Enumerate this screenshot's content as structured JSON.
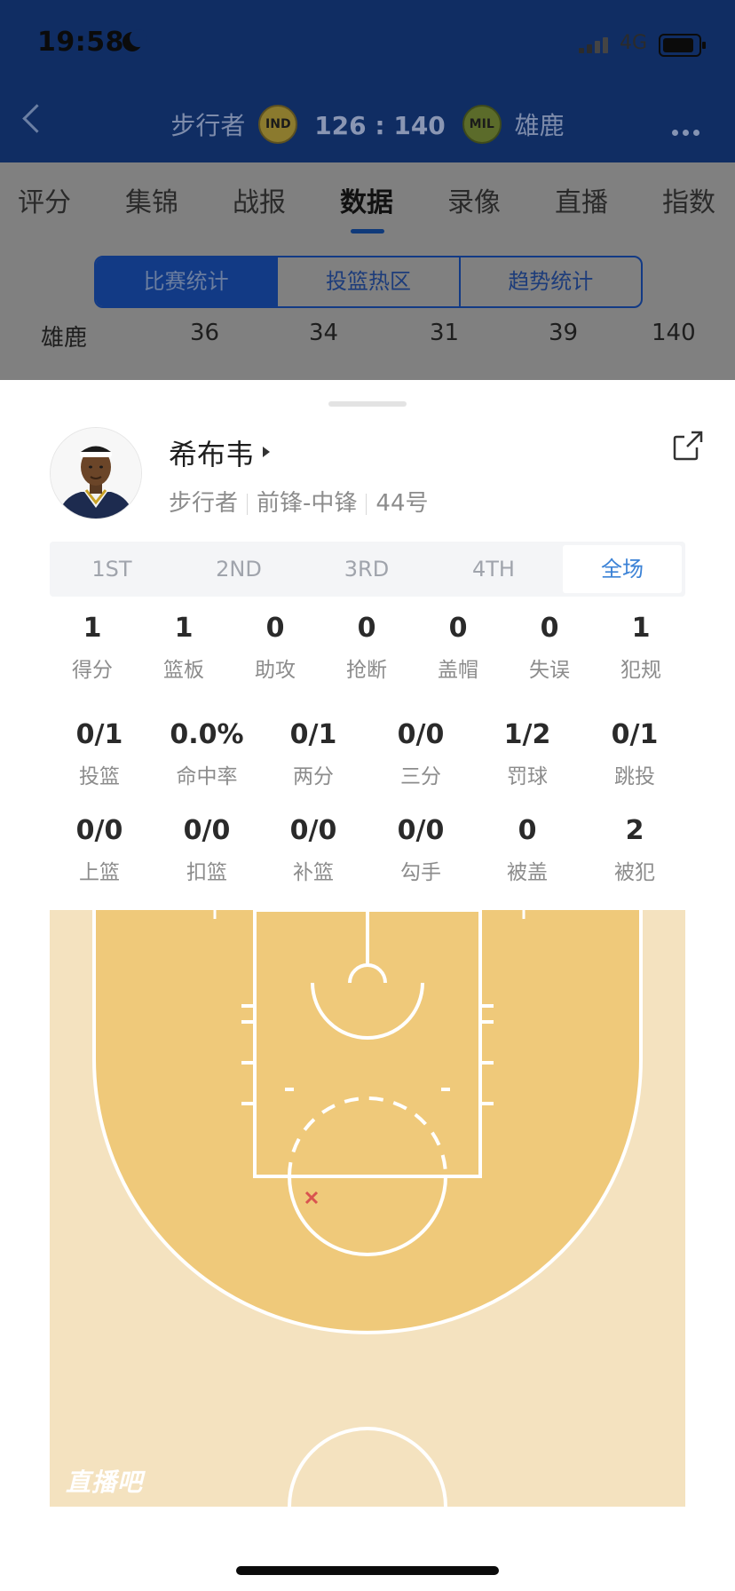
{
  "status_bar": {
    "time": "19:58",
    "network": "4G"
  },
  "header": {
    "home_team": "步行者",
    "home_logo_text": "IND",
    "score": "126 : 140",
    "away_logo_text": "MIL",
    "away_team": "雄鹿"
  },
  "tabs": [
    "评分",
    "集锦",
    "战报",
    "数据",
    "录像",
    "直播",
    "指数"
  ],
  "active_tab": "数据",
  "segments": [
    "比赛统计",
    "投篮热区",
    "趋势统计"
  ],
  "quarter_row": {
    "team": "雄鹿",
    "q1": "36",
    "q2": "34",
    "q3": "31",
    "q4": "39",
    "total": "140"
  },
  "player": {
    "name": "希布韦",
    "team": "步行者",
    "position": "前锋-中锋",
    "number": "44号"
  },
  "periods": [
    "1ST",
    "2ND",
    "3RD",
    "4TH",
    "全场"
  ],
  "active_period": "全场",
  "stats_row1": [
    {
      "value": "1",
      "label": "得分"
    },
    {
      "value": "1",
      "label": "篮板"
    },
    {
      "value": "0",
      "label": "助攻"
    },
    {
      "value": "0",
      "label": "抢断"
    },
    {
      "value": "0",
      "label": "盖帽"
    },
    {
      "value": "0",
      "label": "失误"
    },
    {
      "value": "1",
      "label": "犯规"
    }
  ],
  "stats_row2": [
    {
      "value": "0/1",
      "label": "投篮"
    },
    {
      "value": "0.0%",
      "label": "命中率"
    },
    {
      "value": "0/1",
      "label": "两分"
    },
    {
      "value": "0/0",
      "label": "三分"
    },
    {
      "value": "1/2",
      "label": "罚球"
    },
    {
      "value": "0/1",
      "label": "跳投"
    }
  ],
  "stats_row3": [
    {
      "value": "0/0",
      "label": "上篮"
    },
    {
      "value": "0/0",
      "label": "扣篮"
    },
    {
      "value": "0/0",
      "label": "补篮"
    },
    {
      "value": "0/0",
      "label": "勾手"
    },
    {
      "value": "0",
      "label": "被盖"
    },
    {
      "value": "2",
      "label": "被犯"
    }
  ],
  "court": {
    "watermark": "直播吧",
    "shots": [
      {
        "result": "miss"
      }
    ]
  },
  "colors": {
    "accent": "#3b82d6",
    "court_light": "#f4e2bf",
    "court_dark": "#efc97a",
    "miss_mark": "#d9534f"
  }
}
